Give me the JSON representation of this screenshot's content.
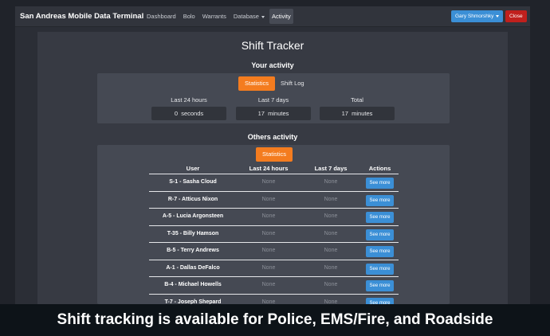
{
  "navbar": {
    "brand": "San Andreas Mobile Data Terminal",
    "items": [
      {
        "label": "Dashboard",
        "active": false
      },
      {
        "label": "Bolo",
        "active": false
      },
      {
        "label": "Warrants",
        "active": false
      },
      {
        "label": "Database",
        "active": false,
        "dropdown": true
      },
      {
        "label": "Activity",
        "active": true
      }
    ],
    "user_button": "Gary Shmorshky",
    "close_button": "Close"
  },
  "page": {
    "title": "Shift Tracker"
  },
  "your_activity": {
    "heading": "Your activity",
    "tabs": [
      {
        "label": "Statistics",
        "active": true
      },
      {
        "label": "Shift Log",
        "active": false
      }
    ],
    "stats": [
      {
        "label": "Last 24 hours",
        "value": "0  seconds"
      },
      {
        "label": "Last 7 days",
        "value": "17  minutes"
      },
      {
        "label": "Total",
        "value": "17  minutes"
      }
    ]
  },
  "others_activity": {
    "heading": "Others activity",
    "tab": "Statistics",
    "columns": [
      "User",
      "Last 24 hours",
      "Last 7 days",
      "Actions"
    ],
    "rows": [
      {
        "user": "S-1 - Sasha Cloud",
        "last24": "None",
        "last7": "None",
        "action": "See more"
      },
      {
        "user": "R-7 - Atticus Nixon",
        "last24": "None",
        "last7": "None",
        "action": "See more"
      },
      {
        "user": "A-5 - Lucia Argonsteen",
        "last24": "None",
        "last7": "None",
        "action": "See more"
      },
      {
        "user": "T-35 - Billy Hamson",
        "last24": "None",
        "last7": "None",
        "action": "See more"
      },
      {
        "user": "B-5 - Terry Andrews",
        "last24": "None",
        "last7": "None",
        "action": "See more"
      },
      {
        "user": "A-1 - Dallas DeFalco",
        "last24": "None",
        "last7": "None",
        "action": "See more"
      },
      {
        "user": "B-4 - Michael Howells",
        "last24": "None",
        "last7": "None",
        "action": "See more"
      },
      {
        "user": "T-7 - Joseph Shepard",
        "last24": "None",
        "last7": "None",
        "action": "See more"
      }
    ]
  },
  "banner": {
    "text": "Shift tracking is available for Police, EMS/Fire, and Roadside"
  },
  "colors": {
    "accent_orange": "#f47c1f",
    "button_blue": "#3b8fd6",
    "close_red": "#c0201d"
  }
}
